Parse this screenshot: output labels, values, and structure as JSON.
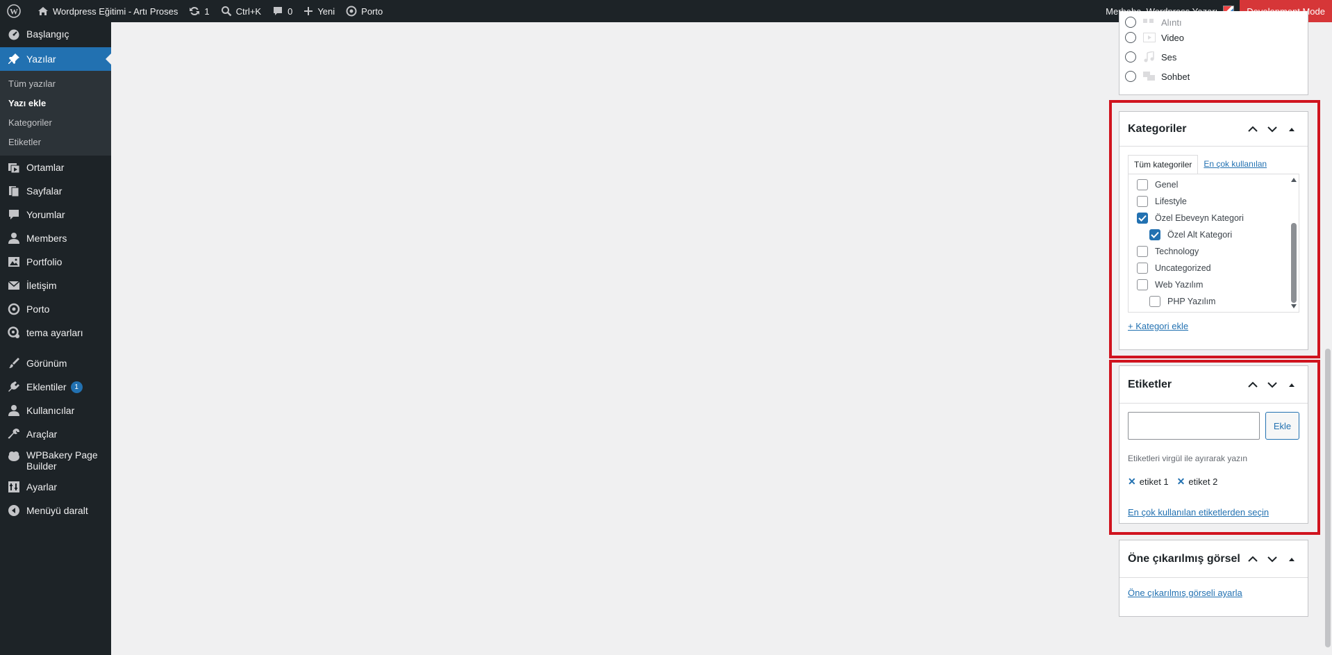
{
  "adminbar": {
    "site_name": "Wordpress Eğitimi - Artı Proses",
    "updates_count": "1",
    "search_shortcut": "Ctrl+K",
    "comments_count": "0",
    "new_label": "Yeni",
    "porto_label": "Porto",
    "greeting": "Merhaba, Wordpress Yazarı",
    "dev_mode": "Development Mode"
  },
  "sidebar": {
    "items": [
      {
        "label": "Başlangıç",
        "icon": "dashboard-icon"
      },
      {
        "label": "Yazılar",
        "icon": "pin-icon",
        "active": true
      },
      {
        "label": "Ortamlar",
        "icon": "media-icon"
      },
      {
        "label": "Sayfalar",
        "icon": "pages-icon"
      },
      {
        "label": "Yorumlar",
        "icon": "comments-icon"
      },
      {
        "label": "Members",
        "icon": "members-icon"
      },
      {
        "label": "Portfolio",
        "icon": "portfolio-icon"
      },
      {
        "label": "İletişim",
        "icon": "mail-icon"
      },
      {
        "label": "Porto",
        "icon": "porto-icon"
      },
      {
        "label": "tema ayarları",
        "icon": "theme-settings-icon"
      },
      {
        "label": "Görünüm",
        "icon": "appearance-icon"
      },
      {
        "label": "Eklentiler",
        "icon": "plugins-icon",
        "badge": "1"
      },
      {
        "label": "Kullanıcılar",
        "icon": "users-icon"
      },
      {
        "label": "Araçlar",
        "icon": "tools-icon"
      },
      {
        "label": "WPBakery Page Builder",
        "icon": "wpbakery-icon"
      },
      {
        "label": "Ayarlar",
        "icon": "settings-icon"
      },
      {
        "label": "Menüyü daralt",
        "icon": "collapse-icon"
      }
    ],
    "submenu": [
      "Tüm yazılar",
      "Yazı ekle",
      "Kategoriler",
      "Etiketler"
    ]
  },
  "format_panel": {
    "options": [
      "Alıntı",
      "Video",
      "Ses",
      "Sohbet"
    ]
  },
  "categories_panel": {
    "title": "Kategoriler",
    "tab_all": "Tüm kategoriler",
    "tab_popular": "En çok kullanılan",
    "items": [
      {
        "label": "Genel",
        "checked": false,
        "child": false
      },
      {
        "label": "Lifestyle",
        "checked": false,
        "child": false
      },
      {
        "label": "Özel Ebeveyn Kategori",
        "checked": true,
        "child": false
      },
      {
        "label": "Özel Alt Kategori",
        "checked": true,
        "child": true
      },
      {
        "label": "Technology",
        "checked": false,
        "child": false
      },
      {
        "label": "Uncategorized",
        "checked": false,
        "child": false
      },
      {
        "label": "Web Yazılım",
        "checked": false,
        "child": false
      },
      {
        "label": "PHP Yazılım",
        "checked": false,
        "child": true
      }
    ],
    "add_link": "+ Kategori ekle"
  },
  "tags_panel": {
    "title": "Etiketler",
    "input_value": "",
    "add_button": "Ekle",
    "hint": "Etiketleri virgül ile ayırarak yazın",
    "tags": [
      "etiket 1",
      "etiket 2"
    ],
    "popular_link": "En çok kullanılan etiketlerden seçin"
  },
  "featured_panel": {
    "title": "Öne çıkarılmış görsel",
    "set_link": "Öne çıkarılmış görseli ayarla"
  },
  "colors": {
    "accent": "#2271b1",
    "highlight": "#d0141f",
    "dev_mode": "#d63638"
  }
}
